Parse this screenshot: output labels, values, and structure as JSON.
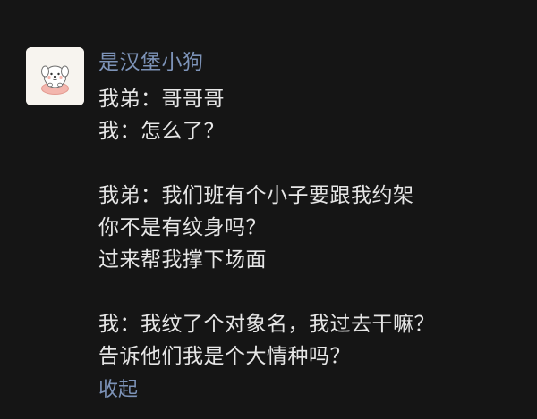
{
  "post": {
    "username": "是汉堡小狗",
    "avatar_icon": "hamburger-dog-avatar",
    "lines": [
      "我弟：哥哥哥",
      "我：怎么了？",
      "",
      "我弟：我们班有个小子要跟我约架",
      "你不是有纹身吗？",
      "过来帮我撑下场面",
      "",
      "我：我纹了个对象名，我过去干嘛？",
      "告诉他们我是个大情种吗？"
    ],
    "collapse_label": "收起"
  },
  "colors": {
    "background": "#141414",
    "text": "#e6e6e6",
    "accent": "#7d93b8"
  }
}
